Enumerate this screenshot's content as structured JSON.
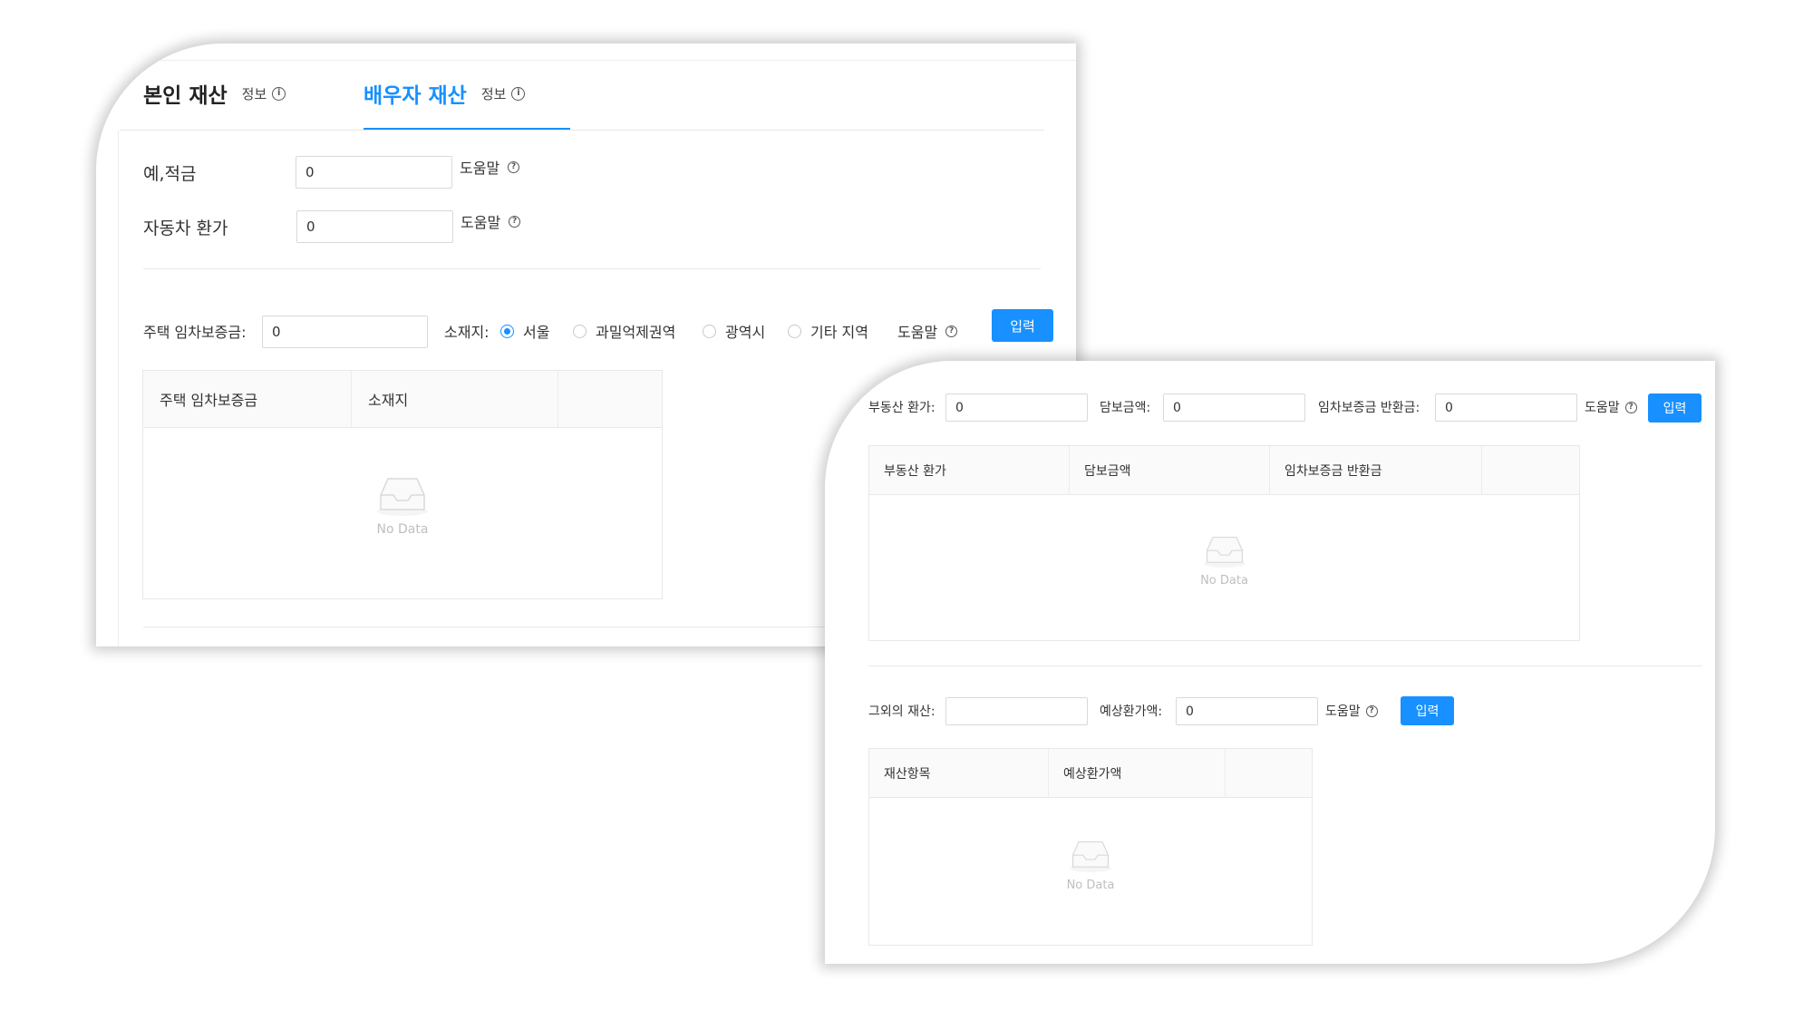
{
  "card1": {
    "tabs": [
      {
        "label": "본인 재산",
        "info": "정보",
        "active": false
      },
      {
        "label": "배우자 재산",
        "info": "정보",
        "active": true
      }
    ],
    "savings": {
      "label": "예,적금",
      "value": "0",
      "help": "도움말"
    },
    "car": {
      "label": "자동차 환가",
      "value": "0",
      "help": "도움말"
    },
    "housing": {
      "label": "주택 임차보증금:",
      "value": "0",
      "location_label": "소재지:",
      "options": [
        "서울",
        "과밀억제권역",
        "광역시",
        "기타 지역"
      ],
      "selected": "서울",
      "help": "도움말",
      "button": "입력"
    },
    "table": {
      "columns": [
        "주택 임차보증금",
        "소재지"
      ],
      "empty": "No Data"
    }
  },
  "card2": {
    "realestate": {
      "label": "부동산 환가:",
      "value": "0",
      "mortgage_label": "담보금액:",
      "mortgage_value": "0",
      "refund_label": "임차보증금 반환금:",
      "refund_value": "0",
      "help": "도움말",
      "button": "입력"
    },
    "table1": {
      "columns": [
        "부동산 환가",
        "담보금액",
        "임차보증금 반환금"
      ],
      "empty": "No Data"
    },
    "other": {
      "label": "그외의 재산:",
      "value": "",
      "estimate_label": "예상환가액:",
      "estimate_value": "0",
      "help": "도움말",
      "button": "입력"
    },
    "table2": {
      "columns": [
        "재산항목",
        "예상환가액"
      ],
      "empty": "No Data"
    }
  },
  "colors": {
    "accent": "#1890ff",
    "border": "#d9d9d9",
    "header_bg": "#fafafa"
  }
}
